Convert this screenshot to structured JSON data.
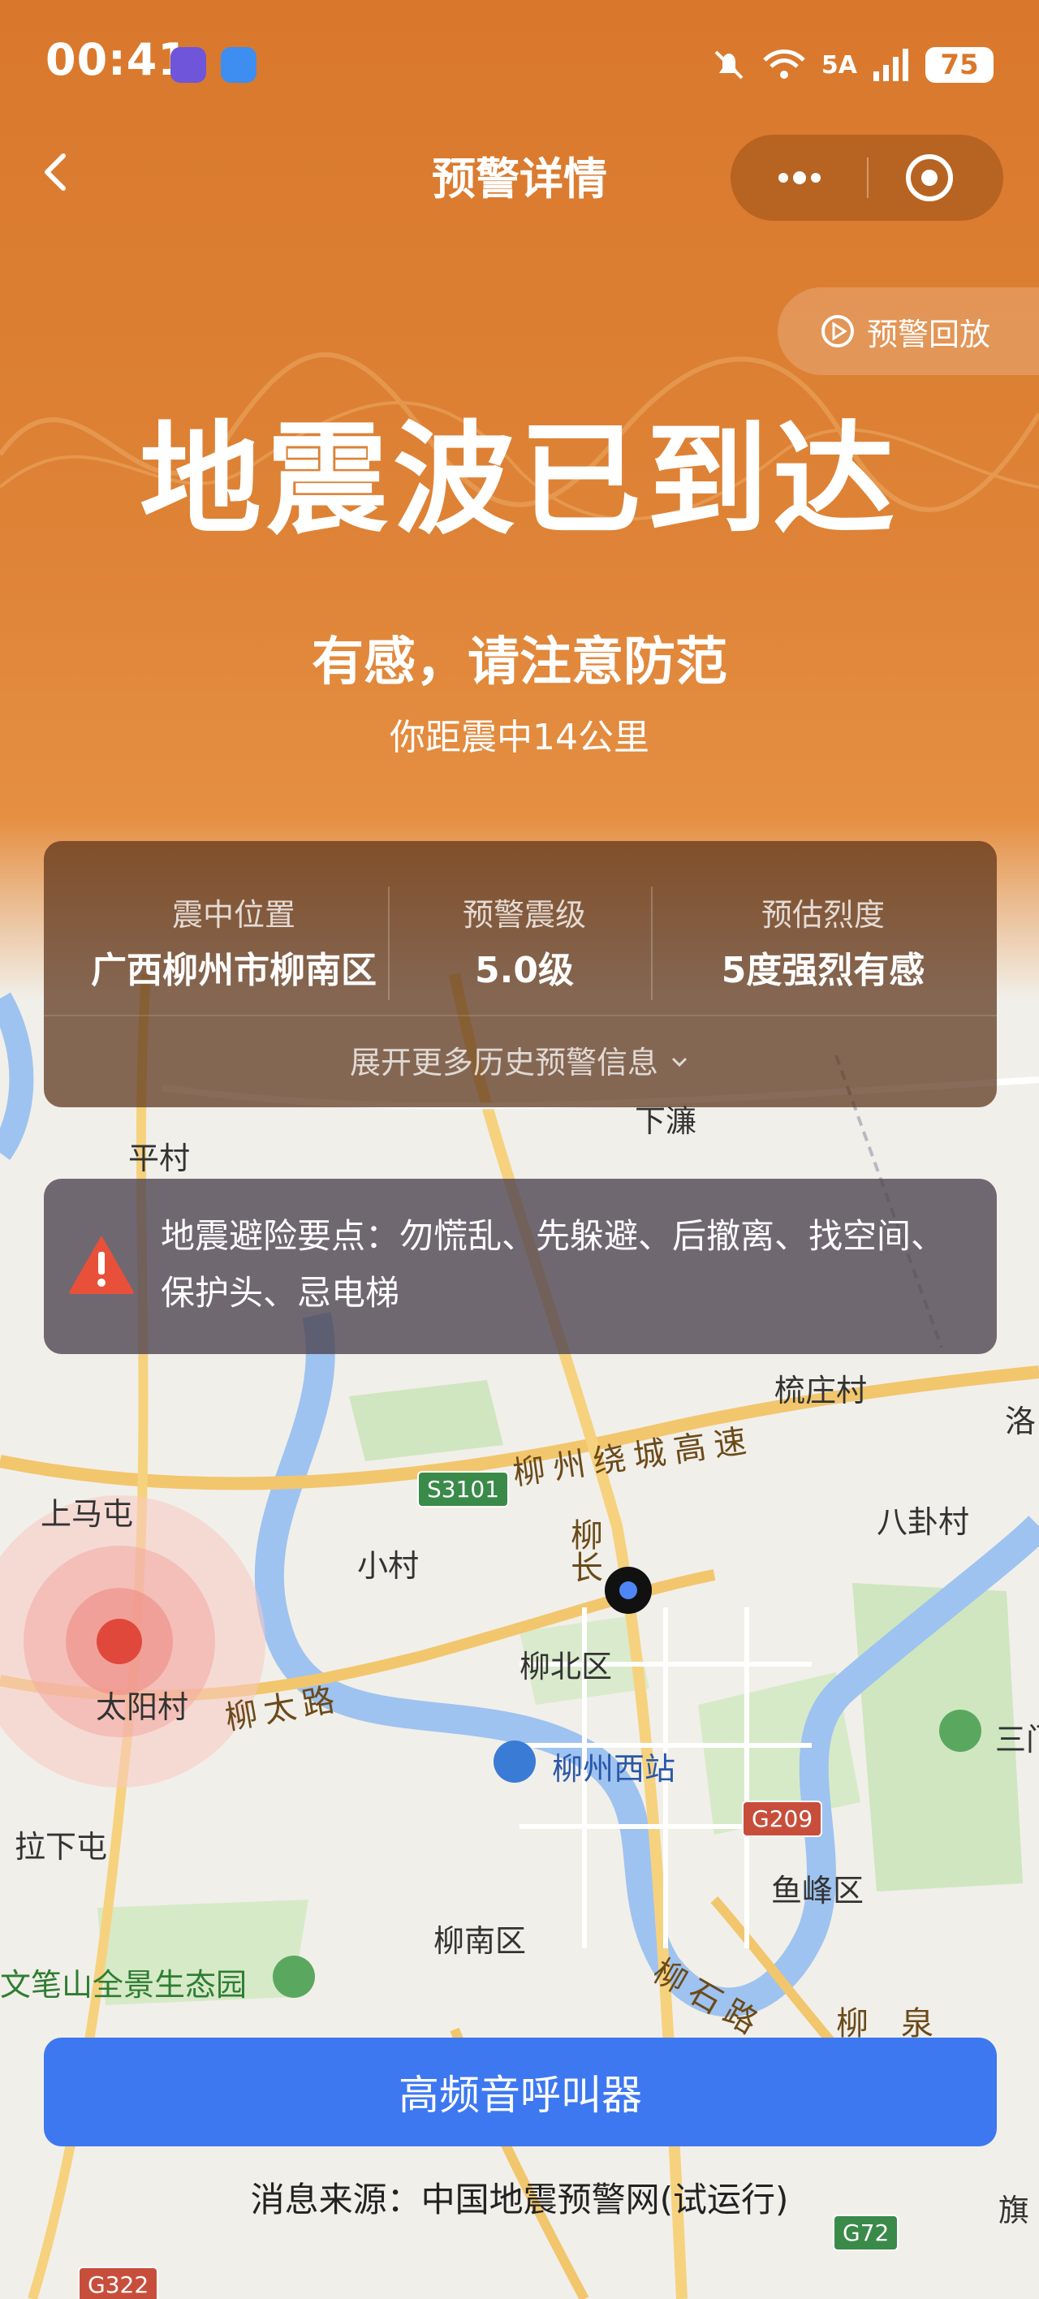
{
  "status_bar": {
    "time": "00:41",
    "network": "5A",
    "battery": "75"
  },
  "nav": {
    "title": "预警详情"
  },
  "replay_label": "预警回放",
  "alert": {
    "headline": "地震波已到达",
    "advice": "有感，请注意防范",
    "distance": "你距震中14公里"
  },
  "info": {
    "epicenter_label": "震中位置",
    "epicenter_value": "广西柳州市柳南区",
    "magnitude_label": "预警震级",
    "magnitude_value": "5.0级",
    "intensity_label": "预估烈度",
    "intensity_value": "5度强烈有感",
    "expand_label": "展开更多历史预警信息"
  },
  "safety_tip": "地震避险要点：勿慌乱、先躲避、后撤离、找空间、保护头、忌电梯",
  "map": {
    "places": {
      "pingcun": "平村",
      "xialian": "下濂",
      "shuzhuang": "梳庄村",
      "shangma": "上马屯",
      "xiaocun": "小村",
      "bagua": "八卦村",
      "liubei": "柳北区",
      "taiyang": "太阳村",
      "lazhu": "拉下屯",
      "liuzhou_west": "柳州西站",
      "yufeng": "鱼峰区",
      "liunan": "柳南区",
      "park": "文笔山全景生态园",
      "luo": "洛",
      "san": "三门",
      "qi": "旗"
    },
    "roads": {
      "ring": "柳州绕城高速",
      "liutai": "柳太路",
      "liuchang": "柳长",
      "liushi": "柳石路",
      "liuquan": "柳泉"
    },
    "shields": {
      "s3101": "S3101",
      "g209": "G209",
      "g72": "G72",
      "g322": "G322"
    }
  },
  "call_button": "高频音呼叫器",
  "source": "消息来源：中国地震预警网(试运行)"
}
